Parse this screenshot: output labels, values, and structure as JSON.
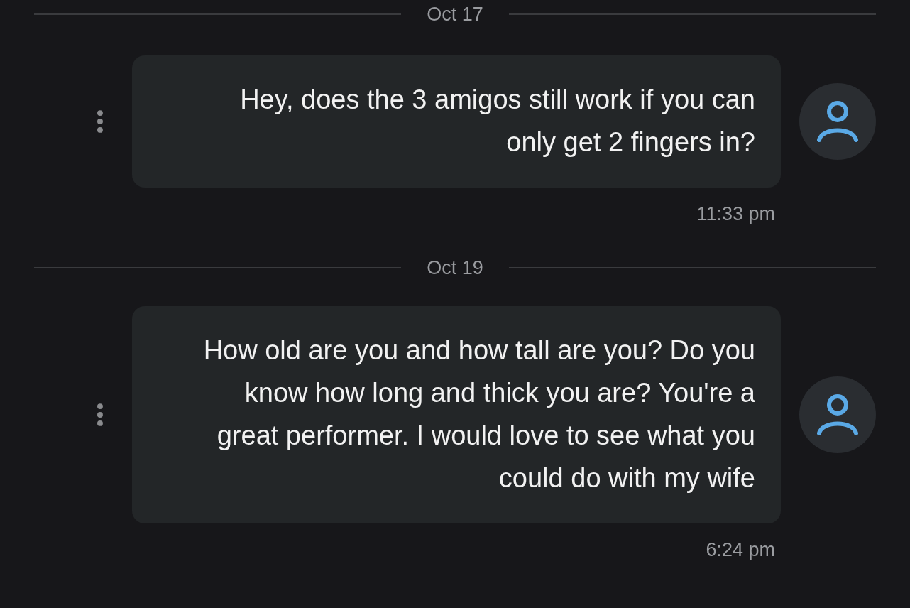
{
  "items": [
    {
      "kind": "date",
      "label": "Oct 17"
    },
    {
      "kind": "message",
      "text": "Hey, does the 3 amigos still work if you can only get 2 fingers in?",
      "time": "11:33 pm"
    },
    {
      "kind": "date",
      "label": "Oct 19"
    },
    {
      "kind": "message",
      "text": "How old are you and how tall are you? Do you know how long and thick you are? You're a great performer. I would love to see what you could do with my wife",
      "time": "6:24 pm"
    }
  ]
}
